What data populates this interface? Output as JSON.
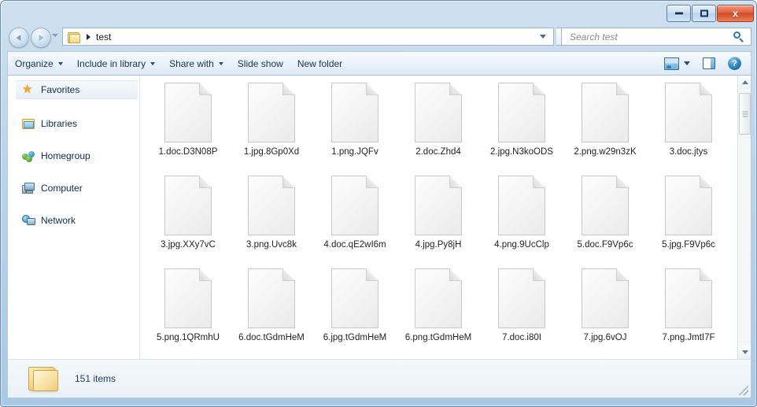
{
  "window": {
    "minimize_label": "Minimize",
    "maximize_label": "Maximize",
    "close_label": "x",
    "accent_color": "#aac8e3",
    "close_color": "#d14a26"
  },
  "address_bar": {
    "folder_icon": "folder-icon",
    "separator": "chevron-right-icon",
    "path_text": "test",
    "dropdown_icon": "chevron-down-icon",
    "refresh_icon": "refresh-icon",
    "refresh_glyph": "↺"
  },
  "search": {
    "placeholder": "Search test",
    "value": "",
    "icon": "search-icon"
  },
  "command_bar": {
    "items": [
      {
        "label": "Organize",
        "has_caret": true
      },
      {
        "label": "Include in library",
        "has_caret": true
      },
      {
        "label": "Share with",
        "has_caret": true
      },
      {
        "label": "Slide show",
        "has_caret": false
      },
      {
        "label": "New folder",
        "has_caret": false
      }
    ],
    "views_icon": "views-icon",
    "views_caret": "chevron-down-icon",
    "preview_pane_icon": "preview-pane-icon",
    "help_icon": "help-icon",
    "help_glyph": "?"
  },
  "nav_pane": {
    "items": [
      {
        "label": "Favorites",
        "icon": "star-icon",
        "selected": true
      },
      {
        "label": "Libraries",
        "icon": "libraries-icon",
        "selected": false
      },
      {
        "label": "Homegroup",
        "icon": "homegroup-icon",
        "selected": false
      },
      {
        "label": "Computer",
        "icon": "computer-icon",
        "selected": false
      },
      {
        "label": "Network",
        "icon": "network-icon",
        "selected": false
      }
    ]
  },
  "files": [
    {
      "name": "1.doc.D3N08P"
    },
    {
      "name": "1.jpg.8Gp0Xd"
    },
    {
      "name": "1.png.JQFv"
    },
    {
      "name": "2.doc.Zhd4"
    },
    {
      "name": "2.jpg.N3koODS"
    },
    {
      "name": "2.png.w29n3zK"
    },
    {
      "name": "3.doc.jtys"
    },
    {
      "name": "3.jpg.XXy7vC"
    },
    {
      "name": "3.png.Uvc8k"
    },
    {
      "name": "4.doc.qE2wI6m"
    },
    {
      "name": "4.jpg.Py8jH"
    },
    {
      "name": "4.png.9UcClp"
    },
    {
      "name": "5.doc.F9Vp6c"
    },
    {
      "name": "5.jpg.F9Vp6c"
    },
    {
      "name": "5.png.1QRmhU"
    },
    {
      "name": "6.doc.tGdmHeM"
    },
    {
      "name": "6.jpg.tGdmHeM"
    },
    {
      "name": "6.png.tGdmHeM"
    },
    {
      "name": "7.doc.i80I"
    },
    {
      "name": "7.jpg.6vOJ"
    },
    {
      "name": "7.png.JmtI7F"
    }
  ],
  "scrollbar": {
    "up_arrow": "scroll-up-icon",
    "down_arrow": "scroll-down-icon"
  },
  "status_bar": {
    "folder_icon": "folder-icon",
    "item_count_text": "151 items"
  }
}
